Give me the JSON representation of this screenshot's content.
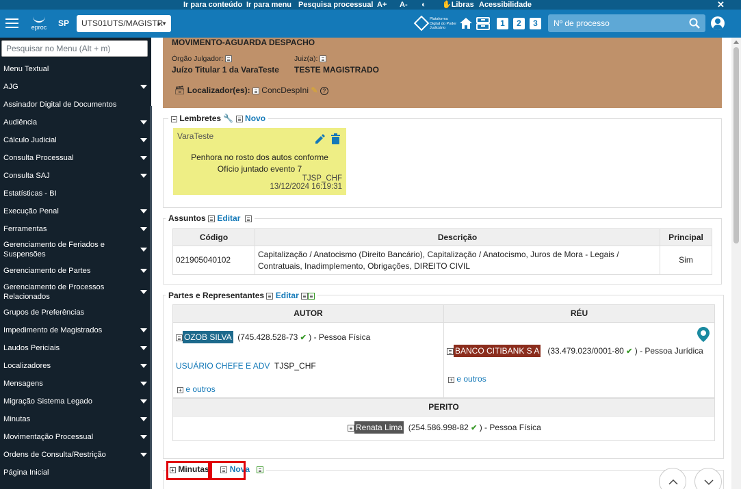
{
  "access_bar": {
    "links": [
      "Ir para conteúdo",
      "Ir para menu",
      "Pesquisa processual",
      "A+",
      "A-",
      "Libras",
      "Acessibilidade"
    ],
    "close": "✕"
  },
  "header": {
    "logo_text": "eproc",
    "uf": "SP",
    "unit_select": "UTS01UTS/MAGISTR",
    "pdpj_text": "Plataforma Digital do Poder Judiciário",
    "process_search_placeholder": "Nº de processo",
    "quick_numbers": [
      "1",
      "2",
      "3"
    ]
  },
  "sidebar": {
    "search_placeholder": "Pesquisar no Menu (Alt + m)",
    "items": [
      {
        "label": "Menu Textual",
        "has_children": false
      },
      {
        "label": "AJG",
        "has_children": true
      },
      {
        "label": "Assinador Digital de Documentos",
        "has_children": false
      },
      {
        "label": "Audiência",
        "has_children": true
      },
      {
        "label": "Cálculo Judicial",
        "has_children": true
      },
      {
        "label": "Consulta Processual",
        "has_children": true
      },
      {
        "label": "Consulta SAJ",
        "has_children": true
      },
      {
        "label": "Estatísticas - BI",
        "has_children": false
      },
      {
        "label": "Execução Penal",
        "has_children": true
      },
      {
        "label": "Ferramentas",
        "has_children": true
      },
      {
        "label": "Gerenciamento de Feriados e Suspensões",
        "has_children": true
      },
      {
        "label": "Gerenciamento de Partes",
        "has_children": true
      },
      {
        "label": "Gerenciamento de Processos Relacionados",
        "has_children": true
      },
      {
        "label": "Grupos de Preferências",
        "has_children": false
      },
      {
        "label": "Impedimento de Magistrados",
        "has_children": true
      },
      {
        "label": "Laudos Periciais",
        "has_children": true
      },
      {
        "label": "Localizadores",
        "has_children": true
      },
      {
        "label": "Mensagens",
        "has_children": true
      },
      {
        "label": "Migração Sistema Legado",
        "has_children": true
      },
      {
        "label": "Minutas",
        "has_children": true
      },
      {
        "label": "Movimentação Processual",
        "has_children": true
      },
      {
        "label": "Ordens de Consulta/Restrição",
        "has_children": true
      },
      {
        "label": "Página Inicial",
        "has_children": false
      }
    ]
  },
  "capa": {
    "status": "MOVIMENTO-AGUARDA DESPACHO",
    "orgao_label": "Órgão Julgador:",
    "orgao_value": "Juízo Titular 1 da VaraTeste",
    "juiz_label": "Juiz(a):",
    "juiz_value": "TESTE MAGISTRADO",
    "localizador_label": "Localizador(es):",
    "localizador_value": "ConcDespIni",
    "help": "?"
  },
  "lembretes": {
    "title": "Lembretes",
    "new_label": "Novo",
    "note": {
      "author": "VaraTeste",
      "text": "Penhora no rosto dos autos conforme Ofício juntado evento 7",
      "user": "TJSP_CHF",
      "date": "13/12/2024 16:19:31"
    }
  },
  "assuntos": {
    "title": "Assuntos",
    "edit_label": "Editar",
    "columns": [
      "Código",
      "Descrição",
      "Principal"
    ],
    "rows": [
      {
        "codigo": "021905040102",
        "descricao": "Capitalização / Anatocismo (Direito Bancário), Capitalização / Anatocismo, Juros de Mora - Legais / Contratuais, Inadimplemento, Obrigações, DIREITO CIVIL",
        "principal": "Sim"
      }
    ]
  },
  "partes": {
    "title": "Partes e Representantes",
    "edit_label": "Editar",
    "autor_header": "AUTOR",
    "reu_header": "RÉU",
    "perito_header": "PERITO",
    "autor": {
      "name": "OZOB SILVA",
      "doc_open": "(745.428.528-73",
      "doc_close": ")",
      "type": "- Pessoa Física",
      "rep_link": "USUÁRIO CHEFE E ADV",
      "rep_user": "TJSP_CHF",
      "outros": "e outros"
    },
    "reu": {
      "name": "BANCO CITIBANK S A",
      "doc_open": "(33.479.023/0001-80",
      "doc_close": ")",
      "type": "- Pessoa Jurídica",
      "outros": "e outros"
    },
    "perito": {
      "name": "Renata Lima",
      "doc_open": "(254.586.998-82",
      "doc_close": ")",
      "type": "-  Pessoa Física"
    },
    "check": "✔",
    "colors": {
      "autor": "#1d6a8c",
      "reu": "#8b2d1d",
      "perito": "#555555"
    }
  },
  "minutas": {
    "title": "Minutas",
    "new_label": "Nova"
  },
  "colors": {
    "header": "#1479b8",
    "access_bar": "#0d5c8a",
    "sidebar": "#14212c",
    "capa": "#bf916a",
    "note": "#eeee85",
    "highlight": "#e0000a"
  }
}
